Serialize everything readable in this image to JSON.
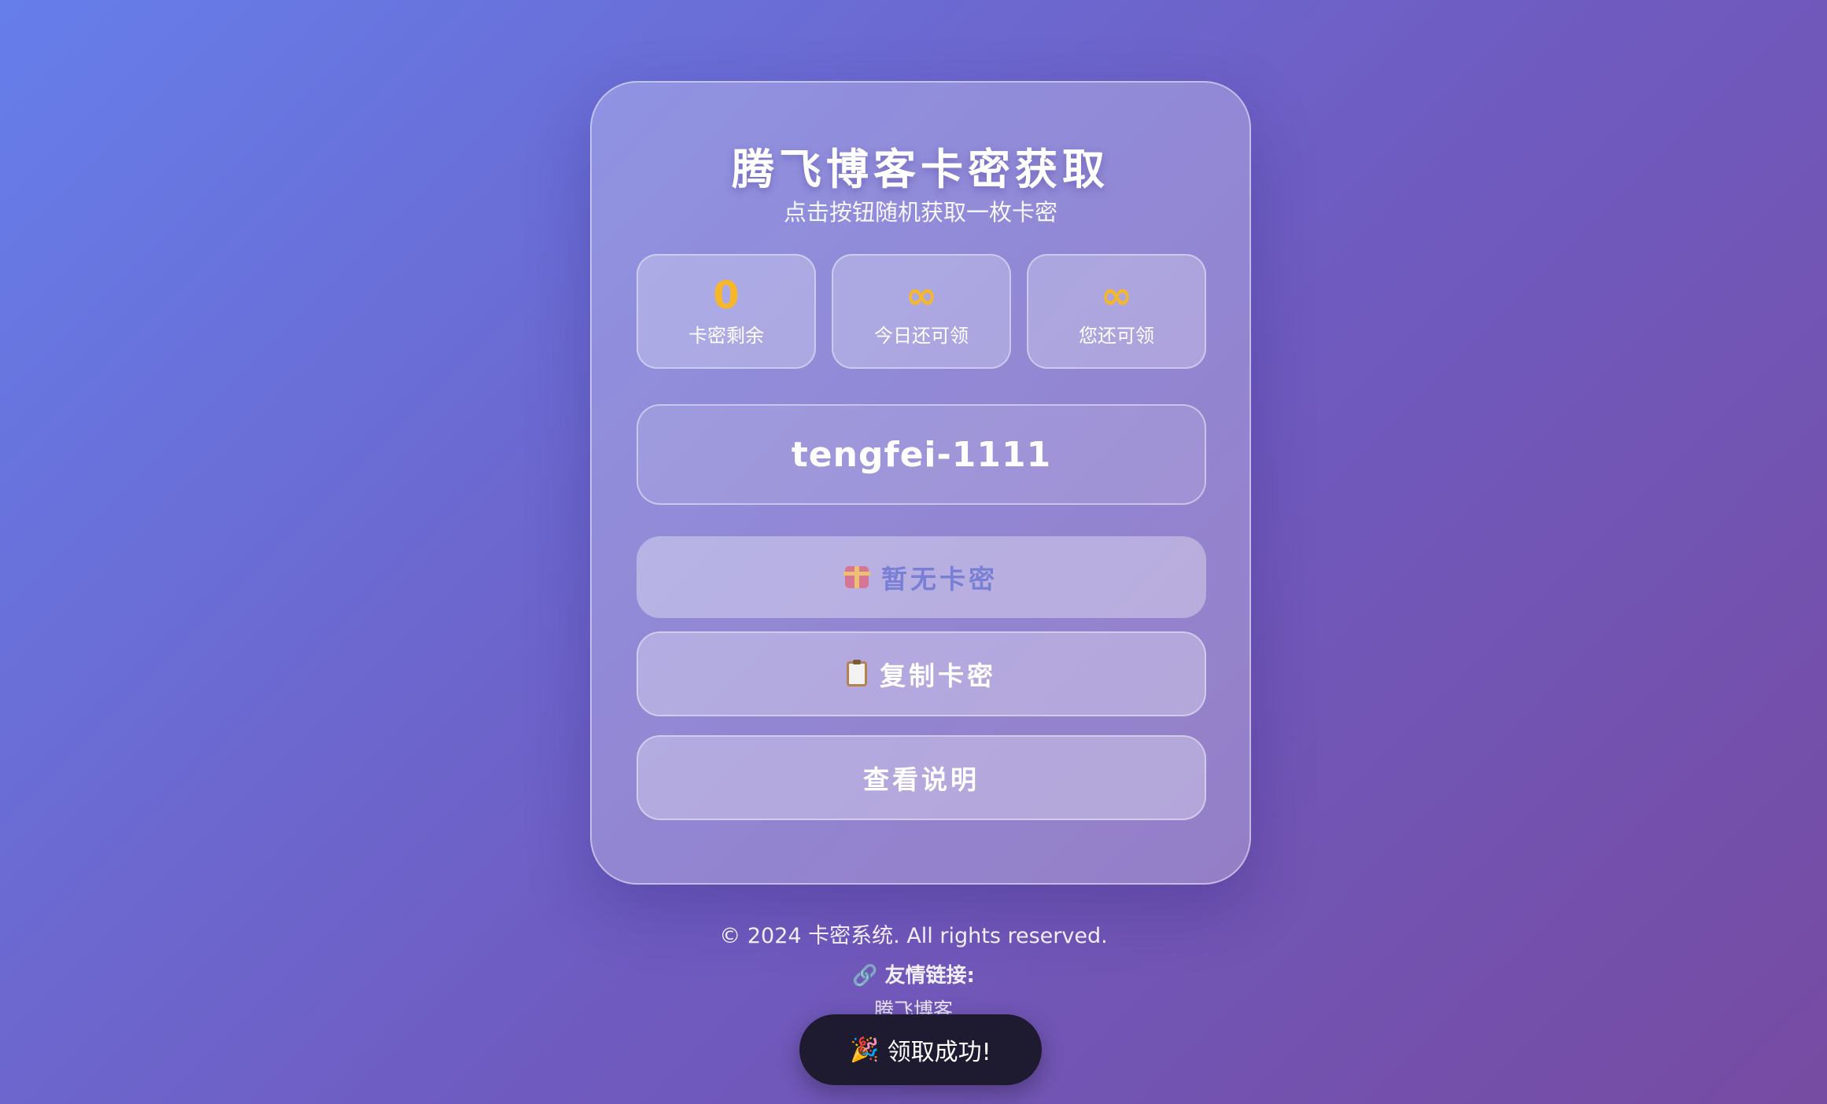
{
  "card": {
    "title": "腾飞博客卡密获取",
    "subtitle": "点击按钮随机获取一枚卡密"
  },
  "stats": [
    {
      "value": "0",
      "label": "卡密剩余"
    },
    {
      "value": "∞",
      "label": "今日还可领"
    },
    {
      "value": "∞",
      "label": "您还可领"
    }
  ],
  "code": "tengfei-1111",
  "buttons": {
    "get_label": "暂无卡密",
    "copy_label": "复制卡密",
    "info_label": "查看说明"
  },
  "footer": {
    "copyright": "© 2024 卡密系统. All rights reserved.",
    "links_label": "🔗 友情链接:",
    "link_item": "腾飞博客"
  },
  "toast": {
    "icon": "🎉",
    "text": "领取成功!"
  },
  "colors": {
    "gradient_start": "#667eea",
    "gradient_end": "#764ba2",
    "stat_value": "#f6b82a",
    "toast_bg": "#1e1a30"
  }
}
